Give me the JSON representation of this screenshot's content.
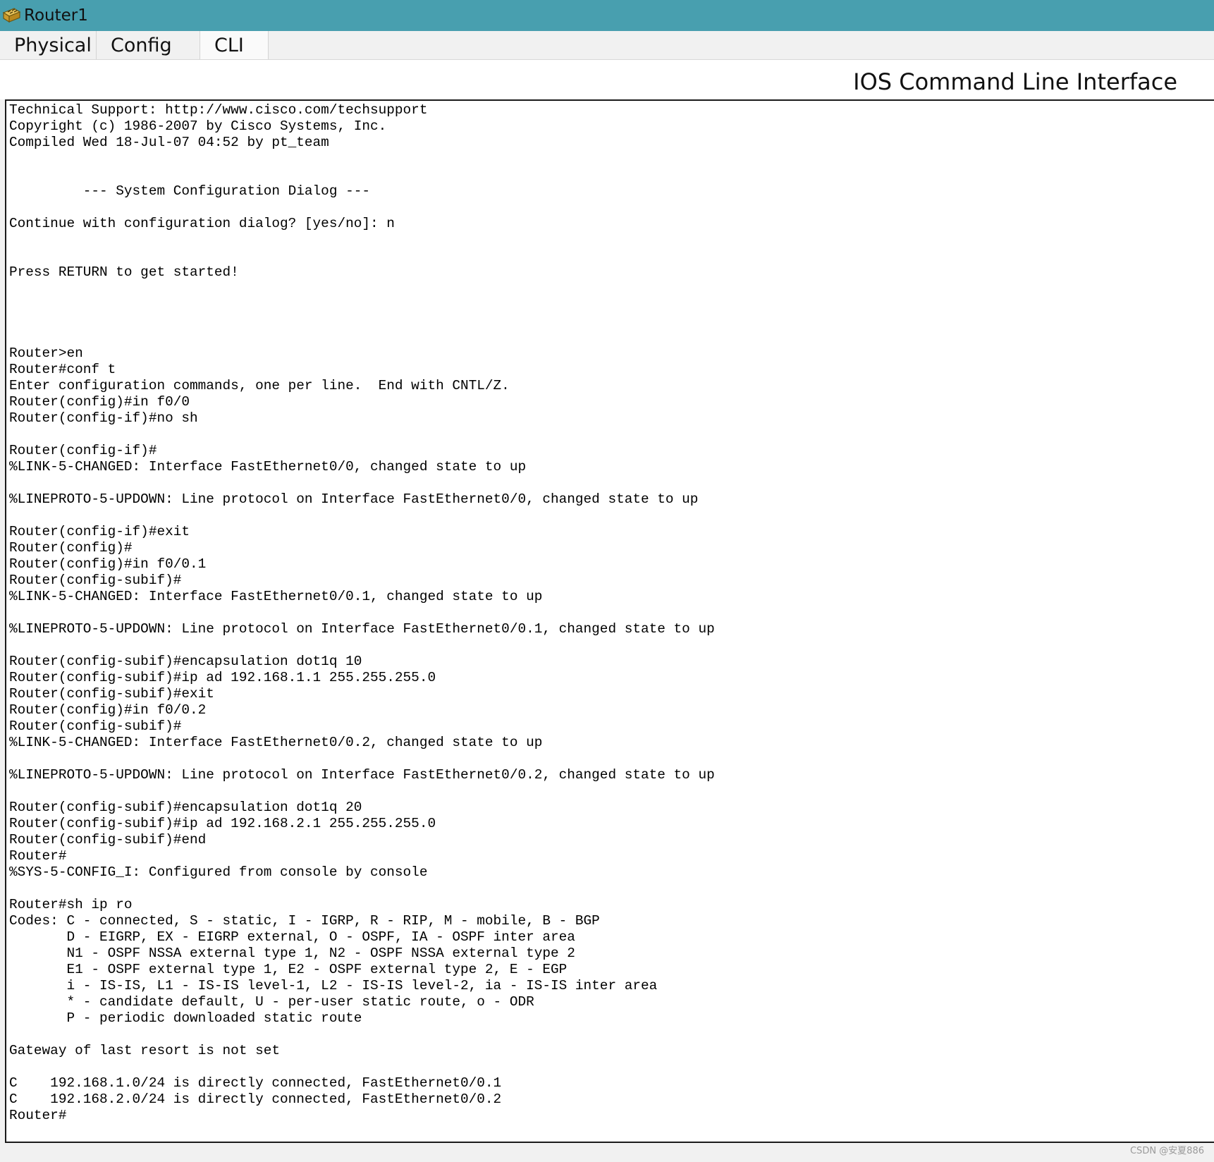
{
  "window": {
    "title": "Router1"
  },
  "tabs": [
    {
      "label": "Physical"
    },
    {
      "label": "Config"
    },
    {
      "label": "CLI"
    }
  ],
  "header": {
    "title": "IOS Command Line Interface"
  },
  "console": {
    "lines": [
      "Technical Support: http://www.cisco.com/techsupport",
      "Copyright (c) 1986-2007 by Cisco Systems, Inc.",
      "Compiled Wed 18-Jul-07 04:52 by pt_team",
      "",
      "",
      "         --- System Configuration Dialog ---",
      "",
      "Continue with configuration dialog? [yes/no]: n",
      "",
      "",
      "Press RETURN to get started!",
      "",
      "",
      "",
      "",
      "Router>en",
      "Router#conf t",
      "Enter configuration commands, one per line.  End with CNTL/Z.",
      "Router(config)#in f0/0",
      "Router(config-if)#no sh",
      "",
      "Router(config-if)#",
      "%LINK-5-CHANGED: Interface FastEthernet0/0, changed state to up",
      "",
      "%LINEPROTO-5-UPDOWN: Line protocol on Interface FastEthernet0/0, changed state to up",
      "",
      "Router(config-if)#exit",
      "Router(config)#",
      "Router(config)#in f0/0.1",
      "Router(config-subif)#",
      "%LINK-5-CHANGED: Interface FastEthernet0/0.1, changed state to up",
      "",
      "%LINEPROTO-5-UPDOWN: Line protocol on Interface FastEthernet0/0.1, changed state to up",
      "",
      "Router(config-subif)#encapsulation dot1q 10",
      "Router(config-subif)#ip ad 192.168.1.1 255.255.255.0",
      "Router(config-subif)#exit",
      "Router(config)#in f0/0.2",
      "Router(config-subif)#",
      "%LINK-5-CHANGED: Interface FastEthernet0/0.2, changed state to up",
      "",
      "%LINEPROTO-5-UPDOWN: Line protocol on Interface FastEthernet0/0.2, changed state to up",
      "",
      "Router(config-subif)#encapsulation dot1q 20",
      "Router(config-subif)#ip ad 192.168.2.1 255.255.255.0",
      "Router(config-subif)#end",
      "Router#",
      "%SYS-5-CONFIG_I: Configured from console by console",
      "",
      "Router#sh ip ro",
      "Codes: C - connected, S - static, I - IGRP, R - RIP, M - mobile, B - BGP",
      "       D - EIGRP, EX - EIGRP external, O - OSPF, IA - OSPF inter area",
      "       N1 - OSPF NSSA external type 1, N2 - OSPF NSSA external type 2",
      "       E1 - OSPF external type 1, E2 - OSPF external type 2, E - EGP",
      "       i - IS-IS, L1 - IS-IS level-1, L2 - IS-IS level-2, ia - IS-IS inter area",
      "       * - candidate default, U - per-user static route, o - ODR",
      "       P - periodic downloaded static route",
      "",
      "Gateway of last resort is not set",
      "",
      "C    192.168.1.0/24 is directly connected, FastEthernet0/0.1",
      "C    192.168.2.0/24 is directly connected, FastEthernet0/0.2",
      "Router#"
    ]
  },
  "watermark": "CSDN @安夏886",
  "colors": {
    "titlebar": "#489faf",
    "console_bg": "#ffffff",
    "window_bg": "#f1f1f1"
  },
  "icons": {
    "app": "router-icon"
  }
}
